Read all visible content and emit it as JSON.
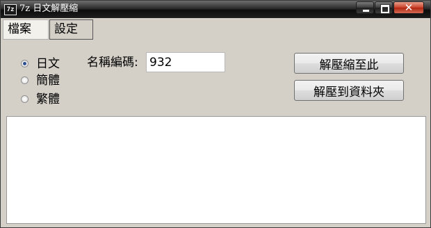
{
  "window": {
    "title": "7z 日文解壓縮",
    "icon_label": "7z",
    "controls": {
      "minimize_icon": "minimize-icon",
      "maximize_icon": "maximize-icon",
      "close_icon": "close-icon",
      "close_glyph": "✕"
    }
  },
  "tabs": [
    {
      "label": "檔案",
      "active": true
    },
    {
      "label": "設定",
      "active": false
    }
  ],
  "encoding_options": [
    {
      "label": "日文",
      "checked": true
    },
    {
      "label": "簡體",
      "checked": false
    },
    {
      "label": "繁體",
      "checked": false
    }
  ],
  "encoding": {
    "label": "名稱編碼:",
    "value": "932"
  },
  "buttons": {
    "extract_here": "解壓縮至此",
    "extract_to_folder": "解壓到資料夾"
  },
  "log": {
    "content": ""
  },
  "colors": {
    "window_bg": "#d4d0c8",
    "close_button": "#c9402a",
    "radio_checked": "#2f4f8f"
  }
}
